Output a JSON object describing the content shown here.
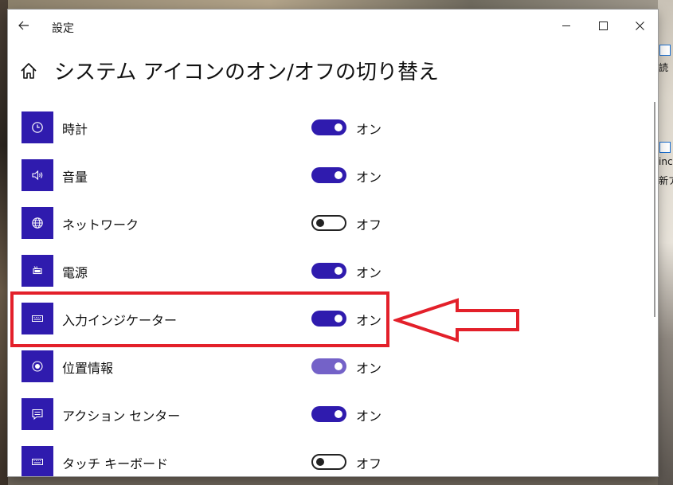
{
  "window": {
    "title": "設定",
    "back_icon": "back-arrow-icon",
    "controls": {
      "minimize": "minimize-icon",
      "maximize": "maximize-icon",
      "close": "close-icon"
    }
  },
  "page": {
    "home_icon": "home-icon",
    "title": "システム アイコンのオン/オフの切り替え"
  },
  "settings": [
    {
      "label": "時計",
      "icon": "clock-icon",
      "state": "オン",
      "on": true
    },
    {
      "label": "音量",
      "icon": "speaker-icon",
      "state": "オン",
      "on": true
    },
    {
      "label": "ネットワーク",
      "icon": "globe-icon",
      "state": "オフ",
      "on": false
    },
    {
      "label": "電源",
      "icon": "battery-icon",
      "state": "オン",
      "on": true
    },
    {
      "label": "入力インジケーター",
      "icon": "keyboard-icon",
      "state": "オン",
      "on": true
    },
    {
      "label": "位置情報",
      "icon": "location-icon",
      "state": "オン",
      "on": true,
      "dimmed": true
    },
    {
      "label": "アクション センター",
      "icon": "message-icon",
      "state": "オン",
      "on": true
    },
    {
      "label": "タッチ キーボード",
      "icon": "keyboard-icon",
      "state": "オフ",
      "on": false
    }
  ],
  "annotation": {
    "highlighted_item": "入力インジケーター",
    "color": "#e3202a"
  },
  "desktop_fragments": [
    "読",
    "inc",
    "新ア"
  ],
  "colors": {
    "accent": "#2f1bae",
    "accent_light": "#7462c8",
    "annotation_red": "#e3202a"
  }
}
